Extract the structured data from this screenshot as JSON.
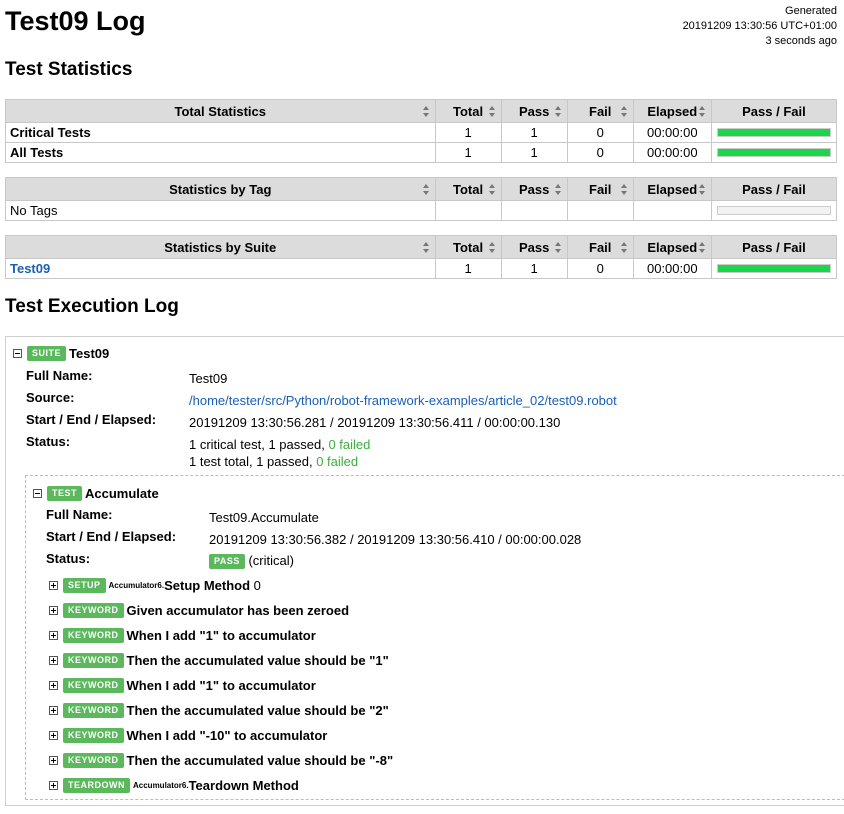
{
  "header": {
    "title": "Test09 Log",
    "generated_label": "Generated",
    "generated_at": "20191209 13:30:56 UTC+01:00",
    "generated_ago": "3 seconds ago"
  },
  "sections": {
    "statistics_heading": "Test Statistics",
    "execution_heading": "Test Execution Log"
  },
  "columns": {
    "total": "Total",
    "pass": "Pass",
    "fail": "Fail",
    "elapsed": "Elapsed",
    "pass_fail": "Pass / Fail"
  },
  "total_statistics": {
    "header": "Total Statistics",
    "rows": [
      {
        "name": "Critical Tests",
        "total": "1",
        "pass": "1",
        "fail": "0",
        "elapsed": "00:00:00",
        "pass_ratio": 1
      },
      {
        "name": "All Tests",
        "total": "1",
        "pass": "1",
        "fail": "0",
        "elapsed": "00:00:00",
        "pass_ratio": 1
      }
    ]
  },
  "tag_statistics": {
    "header": "Statistics by Tag",
    "rows": [
      {
        "name": "No Tags",
        "pass_ratio": 0
      }
    ]
  },
  "suite_statistics": {
    "header": "Statistics by Suite",
    "rows": [
      {
        "name": "Test09",
        "total": "1",
        "pass": "1",
        "fail": "0",
        "elapsed": "00:00:00",
        "pass_ratio": 1
      }
    ]
  },
  "suite": {
    "badge": "SUITE",
    "name": "Test09",
    "full_name_label": "Full Name:",
    "full_name": "Test09",
    "source_label": "Source:",
    "source": "/home/tester/src/Python/robot-framework-examples/article_02/test09.robot",
    "times_label": "Start / End / Elapsed:",
    "times": "20191209 13:30:56.281 / 20191209 13:30:56.411 / 00:00:00.130",
    "status_label": "Status:",
    "status_line1": "1 critical test, 1 passed, ",
    "status_line1_failed": "0 failed",
    "status_line2": "1 test total, 1 passed, ",
    "status_line2_failed": "0 failed"
  },
  "test": {
    "badge": "TEST",
    "name": "Accumulate",
    "full_name_label": "Full Name:",
    "full_name": "Test09.Accumulate",
    "times_label": "Start / End / Elapsed:",
    "times": "20191209 13:30:56.382 / 20191209 13:30:56.410 / 00:00:00.028",
    "status_label": "Status:",
    "status_badge": "PASS",
    "status_note": "(critical)"
  },
  "keywords": [
    {
      "badge": "SETUP",
      "lib": "Accumulator6.",
      "name": "Setup Method",
      "args": " 0"
    },
    {
      "badge": "KEYWORD",
      "lib": "",
      "name": "Given accumulator has been zeroed",
      "args": ""
    },
    {
      "badge": "KEYWORD",
      "lib": "",
      "name": "When I add \"1\" to accumulator",
      "args": ""
    },
    {
      "badge": "KEYWORD",
      "lib": "",
      "name": "Then the accumulated value should be \"1\"",
      "args": ""
    },
    {
      "badge": "KEYWORD",
      "lib": "",
      "name": "When I add \"1\" to accumulator",
      "args": ""
    },
    {
      "badge": "KEYWORD",
      "lib": "",
      "name": "Then the accumulated value should be \"2\"",
      "args": ""
    },
    {
      "badge": "KEYWORD",
      "lib": "",
      "name": "When I add \"-10\" to accumulator",
      "args": ""
    },
    {
      "badge": "KEYWORD",
      "lib": "",
      "name": "Then the accumulated value should be \"-8\"",
      "args": ""
    },
    {
      "badge": "TEARDOWN",
      "lib": "Accumulator6.",
      "name": "Teardown Method",
      "args": ""
    }
  ],
  "colors": {
    "pass_bar": "#1bd64a",
    "badge": "#5cb85c",
    "link": "#1a5fb4",
    "failed_text": "#3cae3c"
  }
}
